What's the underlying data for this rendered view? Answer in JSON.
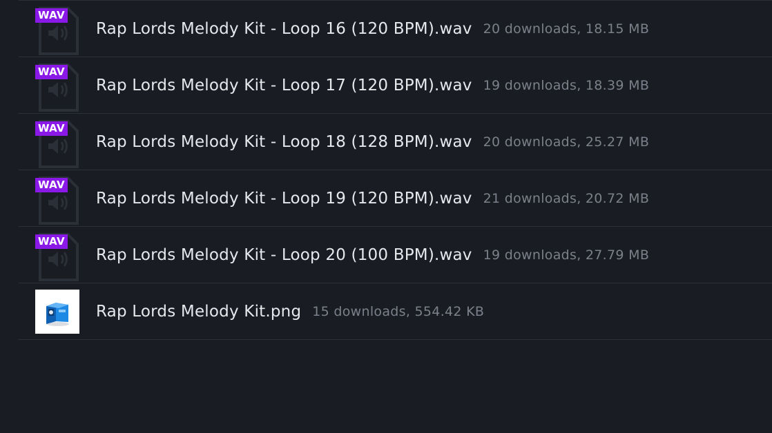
{
  "files": [
    {
      "badge": "WAV",
      "name": "Rap Lords Melody Kit - Loop 16 (120 BPM).wav",
      "meta": "20 downloads, 18.15 MB",
      "type": "audio"
    },
    {
      "badge": "WAV",
      "name": "Rap Lords Melody Kit - Loop 17 (120 BPM).wav",
      "meta": "19 downloads, 18.39 MB",
      "type": "audio"
    },
    {
      "badge": "WAV",
      "name": "Rap Lords Melody Kit - Loop 18 (128 BPM).wav",
      "meta": "20 downloads, 25.27 MB",
      "type": "audio"
    },
    {
      "badge": "WAV",
      "name": "Rap Lords Melody Kit - Loop 19 (120 BPM).wav",
      "meta": "21 downloads, 20.72 MB",
      "type": "audio"
    },
    {
      "badge": "WAV",
      "name": "Rap Lords Melody Kit - Loop 20 (100 BPM).wav",
      "meta": "19 downloads, 27.79 MB",
      "type": "audio"
    },
    {
      "name": "Rap Lords Melody Kit.png",
      "meta": "15 downloads, 554.42 KB",
      "type": "image"
    }
  ],
  "colors": {
    "background": "#191c23",
    "badge": "#8a19e8",
    "divider": "#2c3038",
    "filename": "#e6e8ec",
    "meta": "#7b808a"
  },
  "icons": {
    "audio": "audio-file-icon",
    "image": "image-thumbnail"
  }
}
